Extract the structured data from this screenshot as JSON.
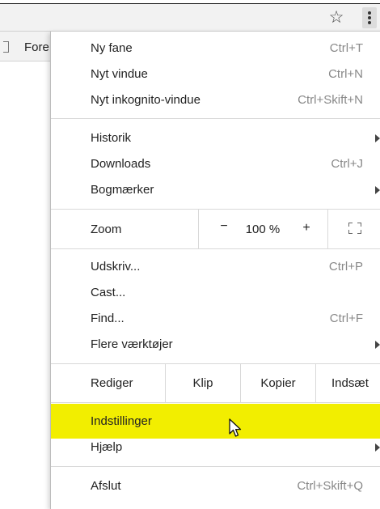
{
  "toolbar": {
    "star_icon": "star-icon",
    "menu_icon": "kebab-menu-icon"
  },
  "bookmarks_bar": {
    "label": "Fore"
  },
  "menu": {
    "group1": [
      {
        "label": "Ny fane",
        "shortcut": "Ctrl+T"
      },
      {
        "label": "Nyt vindue",
        "shortcut": "Ctrl+N"
      },
      {
        "label": "Nyt inkognito-vindue",
        "shortcut": "Ctrl+Skift+N"
      }
    ],
    "group2": [
      {
        "label": "Historik",
        "shortcut": ""
      },
      {
        "label": "Downloads",
        "shortcut": "Ctrl+J"
      },
      {
        "label": "Bogmærker",
        "shortcut": ""
      }
    ],
    "zoom": {
      "label": "Zoom",
      "minus": "−",
      "value": "100 %",
      "plus": "+"
    },
    "group3": [
      {
        "label": "Udskriv...",
        "shortcut": "Ctrl+P"
      },
      {
        "label": "Cast...",
        "shortcut": ""
      },
      {
        "label": "Find...",
        "shortcut": "Ctrl+F"
      },
      {
        "label": "Flere værktøjer",
        "shortcut": ""
      }
    ],
    "edit": {
      "label": "Rediger",
      "cut": "Klip",
      "copy": "Kopier",
      "paste": "Indsæt"
    },
    "group4": [
      {
        "label": "Indstillinger",
        "shortcut": "",
        "highlight_color": "#f2ee00"
      },
      {
        "label": "Hjælp",
        "shortcut": ""
      }
    ],
    "exit": {
      "label": "Afslut",
      "shortcut": "Ctrl+Skift+Q"
    }
  }
}
